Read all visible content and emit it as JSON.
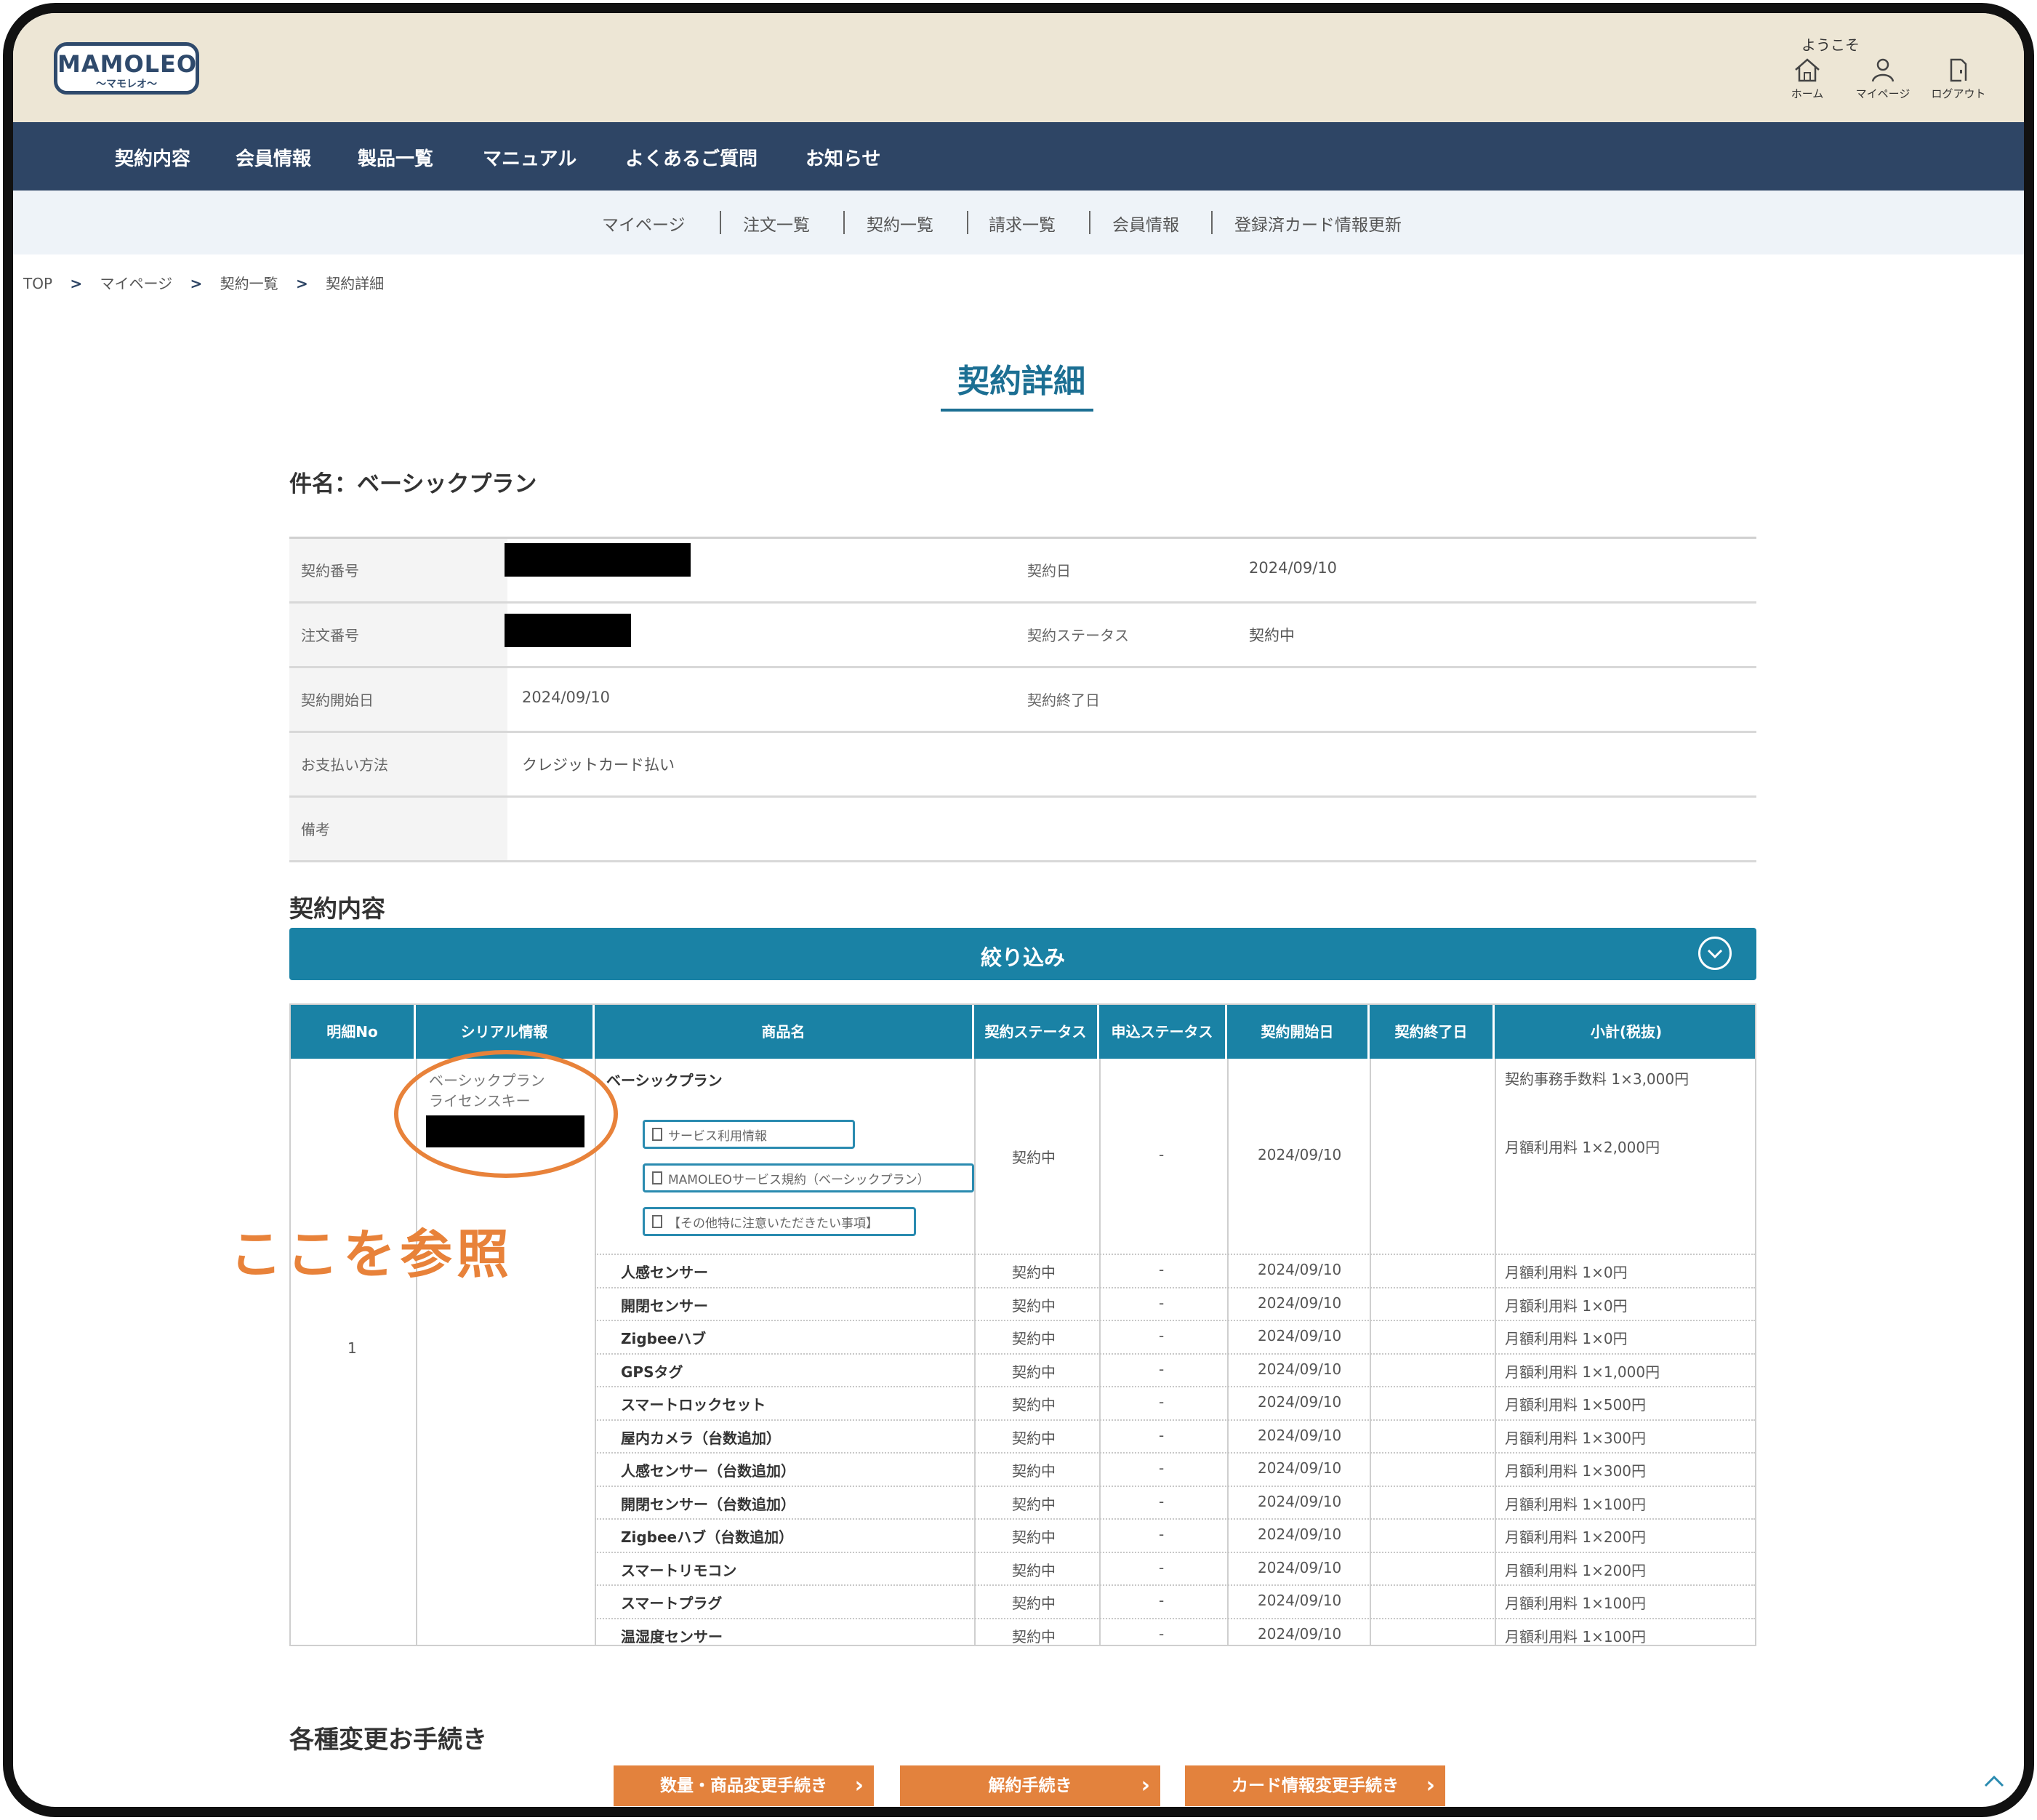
{
  "header": {
    "logo_main": "MAMOLEO",
    "logo_sub": "〜マモレオ〜",
    "welcome": "ようこそ",
    "icons": [
      {
        "icon": "home-icon",
        "label": "ホーム"
      },
      {
        "icon": "user-icon",
        "label": "マイページ"
      },
      {
        "icon": "logout-icon",
        "label": "ログアウト"
      }
    ]
  },
  "nav": [
    "契約内容",
    "会員情報",
    "製品一覧",
    "マニュアル",
    "よくあるご質問",
    "お知らせ"
  ],
  "subnav": [
    "マイページ",
    "注文一覧",
    "契約一覧",
    "請求一覧",
    "会員情報",
    "登録済カード情報更新"
  ],
  "breadcrumb": [
    "TOP",
    "マイページ",
    "契約一覧",
    "契約詳細"
  ],
  "breadcrumb_sep": ">",
  "page_title": "契約詳細",
  "subject": "件名：ベーシックプラン",
  "info": {
    "contract_no_label": "契約番号",
    "contract_date_label": "契約日",
    "contract_date": "2024/09/10",
    "order_no_label": "注文番号",
    "status_label": "契約ステータス",
    "status": "契約中",
    "start_label": "契約開始日",
    "start": "2024/09/10",
    "end_label": "契約終了日",
    "payment_label": "お支払い方法",
    "payment": "クレジットカード払い",
    "notes_label": "備考"
  },
  "contract_heading": "契約内容",
  "filter_label": "絞り込み",
  "table": {
    "headers": [
      "明細No",
      "シリアル情報",
      "商品名",
      "契約ステータス",
      "申込ステータス",
      "契約開始日",
      "契約終了日",
      "小計(税抜)"
    ],
    "detail_no": "1",
    "serial_line1": "ベーシックプラン",
    "serial_line2": "ライセンスキー",
    "main_product": "ベーシックプラン",
    "main_status": "契約中",
    "main_apply": "-",
    "main_start": "2024/09/10",
    "main_fee1": "契約事務手数料 1×3,000円",
    "main_fee2": "月額利用料 1×2,000円",
    "doc_buttons": [
      "サービス利用情報",
      "MAMOLEOサービス規約（ベーシックプラン）",
      "【その他特に注意いただきたい事項】"
    ],
    "rows": [
      {
        "name": "人感センサー",
        "status": "契約中",
        "apply": "-",
        "start": "2024/09/10",
        "fee": "月額利用料 1×0円"
      },
      {
        "name": "開閉センサー",
        "status": "契約中",
        "apply": "-",
        "start": "2024/09/10",
        "fee": "月額利用料 1×0円"
      },
      {
        "name": "Zigbeeハブ",
        "status": "契約中",
        "apply": "-",
        "start": "2024/09/10",
        "fee": "月額利用料 1×0円"
      },
      {
        "name": "GPSタグ",
        "status": "契約中",
        "apply": "-",
        "start": "2024/09/10",
        "fee": "月額利用料 1×1,000円"
      },
      {
        "name": "スマートロックセット",
        "status": "契約中",
        "apply": "-",
        "start": "2024/09/10",
        "fee": "月額利用料 1×500円"
      },
      {
        "name": "屋内カメラ（台数追加）",
        "status": "契約中",
        "apply": "-",
        "start": "2024/09/10",
        "fee": "月額利用料 1×300円"
      },
      {
        "name": "人感センサー（台数追加）",
        "status": "契約中",
        "apply": "-",
        "start": "2024/09/10",
        "fee": "月額利用料 1×300円"
      },
      {
        "name": "開閉センサー（台数追加）",
        "status": "契約中",
        "apply": "-",
        "start": "2024/09/10",
        "fee": "月額利用料 1×100円"
      },
      {
        "name": "Zigbeeハブ（台数追加）",
        "status": "契約中",
        "apply": "-",
        "start": "2024/09/10",
        "fee": "月額利用料 1×200円"
      },
      {
        "name": "スマートリモコン",
        "status": "契約中",
        "apply": "-",
        "start": "2024/09/10",
        "fee": "月額利用料 1×200円"
      },
      {
        "name": "スマートプラグ",
        "status": "契約中",
        "apply": "-",
        "start": "2024/09/10",
        "fee": "月額利用料 1×100円"
      },
      {
        "name": "温湿度センサー",
        "status": "契約中",
        "apply": "-",
        "start": "2024/09/10",
        "fee": "月額利用料 1×100円"
      }
    ]
  },
  "annotation": "ここを参照",
  "procedures_heading": "各種変更お手続き",
  "procedure_buttons": [
    "数量・商品変更手続き",
    "解約手続き",
    "カード情報変更手続き"
  ],
  "colors": {
    "navy": "#2e4565",
    "teal": "#1a82a5",
    "orange": "#e3823d",
    "header_bg": "#ede6d5"
  }
}
